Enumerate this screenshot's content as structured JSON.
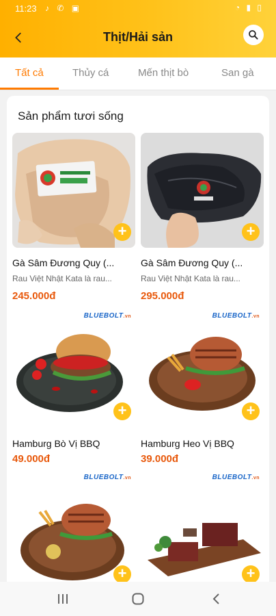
{
  "status": {
    "time": "11:23"
  },
  "header": {
    "title": "Thịt/Hải sản"
  },
  "tabs": [
    {
      "label": "Tất cả",
      "active": true
    },
    {
      "label": "Thủy cá",
      "active": false
    },
    {
      "label": "Mến thịt bò",
      "active": false
    },
    {
      "label": "San gà",
      "active": false
    }
  ],
  "section": {
    "title": "Sản phẩm tươi sống"
  },
  "brand": {
    "name": "BLUEBOLT",
    "domain": ".vn"
  },
  "products": [
    {
      "name": "Gà Sâm Đương Quy (...",
      "desc": "Rau Việt Nhật Kata là rau...",
      "price": "245.000đ"
    },
    {
      "name": "Gà Sâm Đương Quy (...",
      "desc": "Rau Việt Nhật Kata là rau...",
      "price": "295.000đ"
    },
    {
      "name": "Hamburg Bò Vị BBQ",
      "price": "49.000đ"
    },
    {
      "name": "Hamburg Heo Vị BBQ",
      "price": "39.000đ"
    }
  ],
  "colors": {
    "accent": "#ff7a00",
    "header": "#ffc21a",
    "price": "#e8590c"
  }
}
